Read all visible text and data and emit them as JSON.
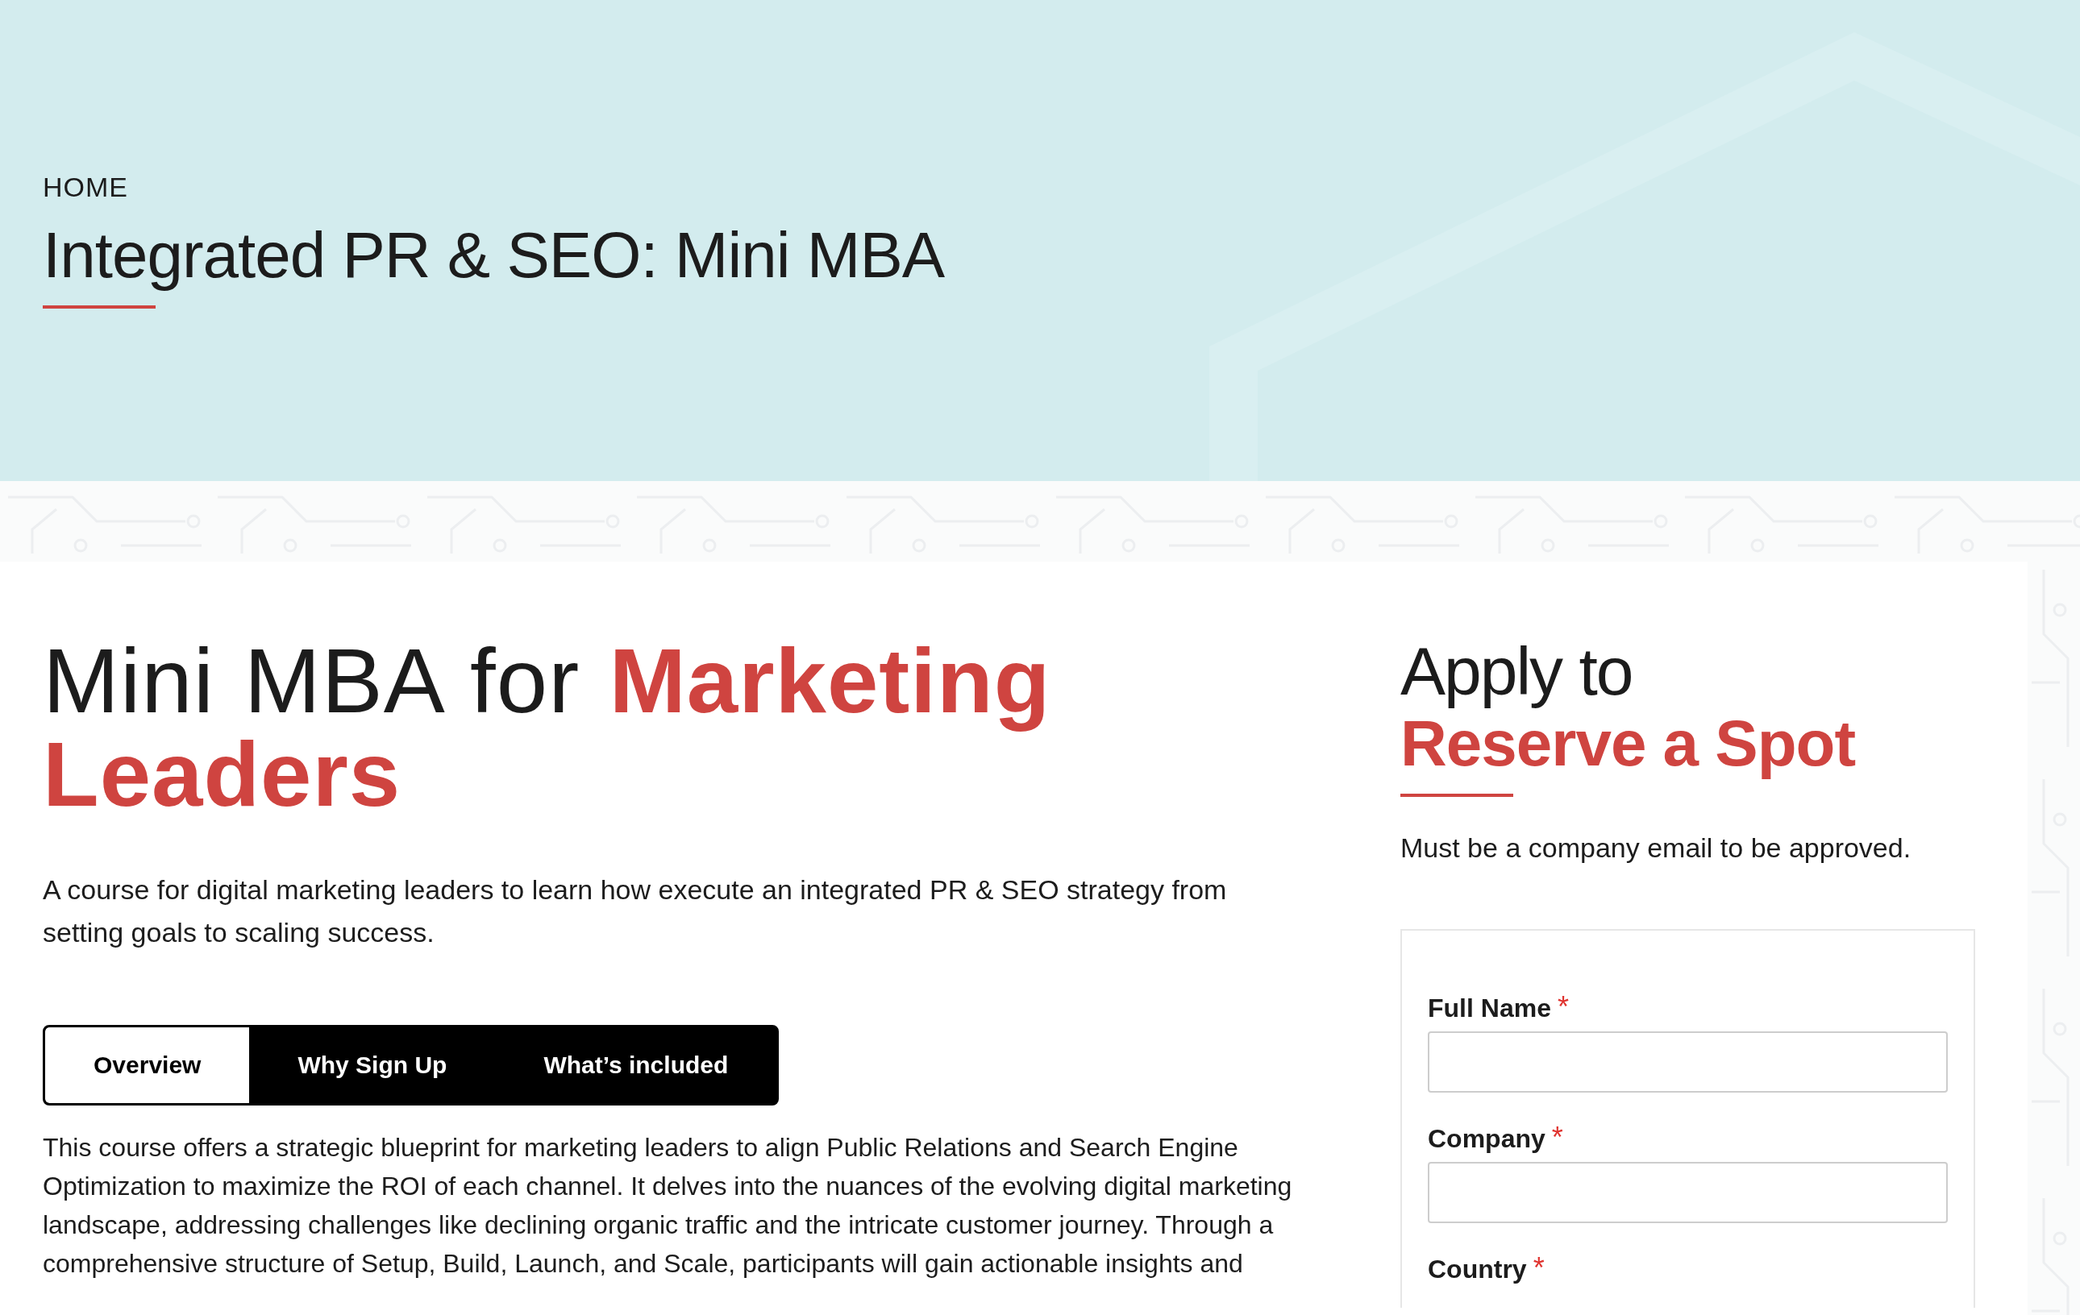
{
  "breadcrumb": "HOME",
  "page_title": "Integrated PR & SEO: Mini MBA",
  "course": {
    "heading": "Mini MBA for **Marketing Leaders**",
    "subtitle": "A course for digital marketing leaders to learn how execute an integrated PR & SEO strategy from setting goals to scaling success.",
    "tabs": [
      {
        "label": "Overview",
        "selected": true
      },
      {
        "label": "Why Sign Up",
        "selected": false
      },
      {
        "label": "What’s included",
        "selected": false
      }
    ],
    "body": "This course offers a strategic blueprint for marketing leaders to align Public Relations and Search Engine Optimization to maximize the ROI of each channel. It delves into the nuances of the evolving digital marketing landscape, addressing challenges like declining organic traffic and the intricate customer journey. Through a comprehensive structure of Setup, Build, Launch, and Scale, participants will gain actionable insights and"
  },
  "apply": {
    "heading": "Apply to **Reserve a Spot**",
    "note": "Must be a company email to be approved.",
    "fields": [
      {
        "label": "Full Name",
        "required_mark": "*",
        "kind": "text"
      },
      {
        "label": "Company",
        "required_mark": "*",
        "kind": "text"
      },
      {
        "label": "Country",
        "required_mark": "*",
        "kind": "label_only"
      }
    ]
  }
}
